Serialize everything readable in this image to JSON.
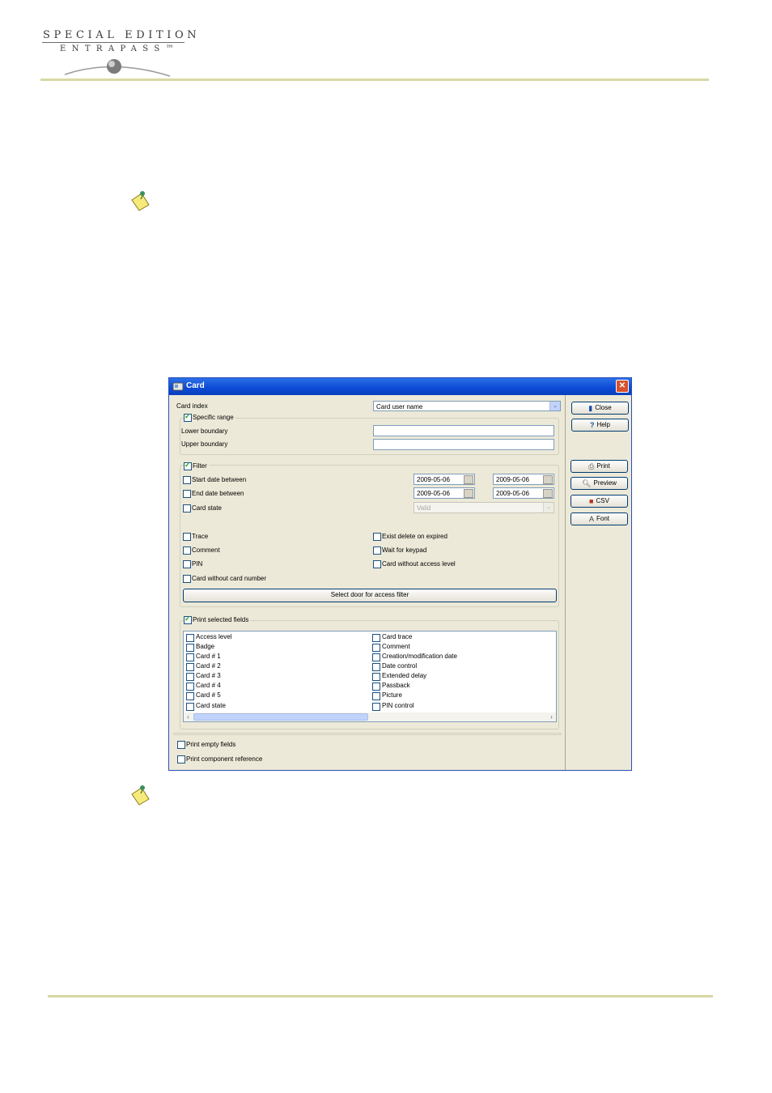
{
  "header": {
    "logo_line1": "SPECIAL EDITION",
    "logo_line2": "ENTRAPASS™"
  },
  "icons": [
    "note-icon",
    "card-icon",
    "close-icon",
    "door-icon",
    "help-icon",
    "printer-icon",
    "preview-icon",
    "floppy-icon",
    "font-icon",
    "calendar-icon",
    "chevron-down-icon"
  ],
  "dialog": {
    "title": "Card",
    "close_glyph": "✕",
    "card_index_label": "Card index",
    "card_index_value": "Card user name",
    "specific_range": {
      "label": "Specific range",
      "checked": true
    },
    "lower_boundary_label": "Lower boundary",
    "lower_boundary_value": "",
    "upper_boundary_label": "Upper boundary",
    "upper_boundary_value": "",
    "filter": {
      "label": "Filter",
      "checked": true
    },
    "start_date": {
      "label": "Start date between",
      "from": "2009-05-06",
      "to": "2009-05-06"
    },
    "end_date": {
      "label": "End date between",
      "from": "2009-05-06",
      "to": "2009-05-06"
    },
    "card_state": {
      "label": "Card state",
      "value": "Valid"
    },
    "options_left": [
      "Trace",
      "Comment",
      "PIN",
      "Card without card number"
    ],
    "options_right": [
      "Exist delete on expired",
      "Wait for keypad",
      "Card without access level"
    ],
    "select_door_button": "Select door for access filter",
    "print_selected_fields": {
      "label": "Print selected fields",
      "checked": true
    },
    "fields_left": [
      "Access level",
      "Badge",
      "Card # 1",
      "Card # 2",
      "Card # 3",
      "Card # 4",
      "Card # 5",
      "Card state"
    ],
    "fields_right": [
      "Card trace",
      "Comment",
      "Creation/modification date",
      "Date control",
      "Extended delay",
      "Passback",
      "Picture",
      "PIN control"
    ],
    "print_empty_fields": "Print empty fields",
    "print_component_reference": "Print component reference",
    "buttons": {
      "close": "Close",
      "help": "Help",
      "print": "Print",
      "preview": "Preview",
      "csv": "CSV",
      "font": "Font"
    }
  },
  "colors": {
    "title_bar": "#0c4ad4",
    "dialog_bg": "#ece9d8",
    "rule": "#d8d8a4"
  }
}
